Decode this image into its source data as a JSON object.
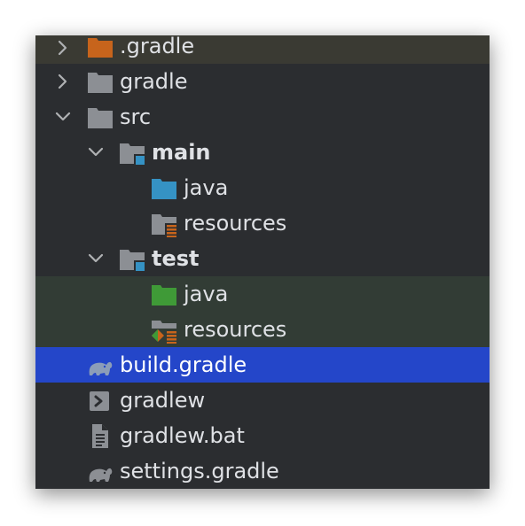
{
  "colors": {
    "panel_bg": "#2b2d30",
    "excluded_bg": "#3a3a33",
    "test_bg": "#323c35",
    "selected_bg": "#2446c9",
    "folder_gray": "#8c8f94",
    "folder_orange": "#c7641c",
    "source_blue": "#3592c4",
    "test_green": "#3f9a37",
    "text": "#dfe1e5"
  },
  "tree": {
    "rows": [
      {
        "label": ".gradle",
        "icon": "folder-excluded-icon",
        "chevron": "chevron-right-icon"
      },
      {
        "label": "gradle",
        "icon": "folder-icon",
        "chevron": "chevron-right-icon"
      },
      {
        "label": "src",
        "icon": "folder-icon",
        "chevron": "chevron-down-icon"
      },
      {
        "label": "main",
        "icon": "module-folder-icon",
        "chevron": "chevron-down-icon"
      },
      {
        "label": "java",
        "icon": "source-root-folder-icon"
      },
      {
        "label": "resources",
        "icon": "resources-root-folder-icon"
      },
      {
        "label": "test",
        "icon": "module-folder-icon",
        "chevron": "chevron-down-icon"
      },
      {
        "label": "java",
        "icon": "test-source-root-folder-icon"
      },
      {
        "label": "resources",
        "icon": "test-resources-root-folder-icon"
      },
      {
        "label": "build.gradle",
        "icon": "gradle-elephant-icon",
        "selected": true
      },
      {
        "label": "gradlew",
        "icon": "shell-script-icon"
      },
      {
        "label": "gradlew.bat",
        "icon": "text-file-icon"
      },
      {
        "label": "settings.gradle",
        "icon": "gradle-elephant-icon"
      }
    ]
  }
}
